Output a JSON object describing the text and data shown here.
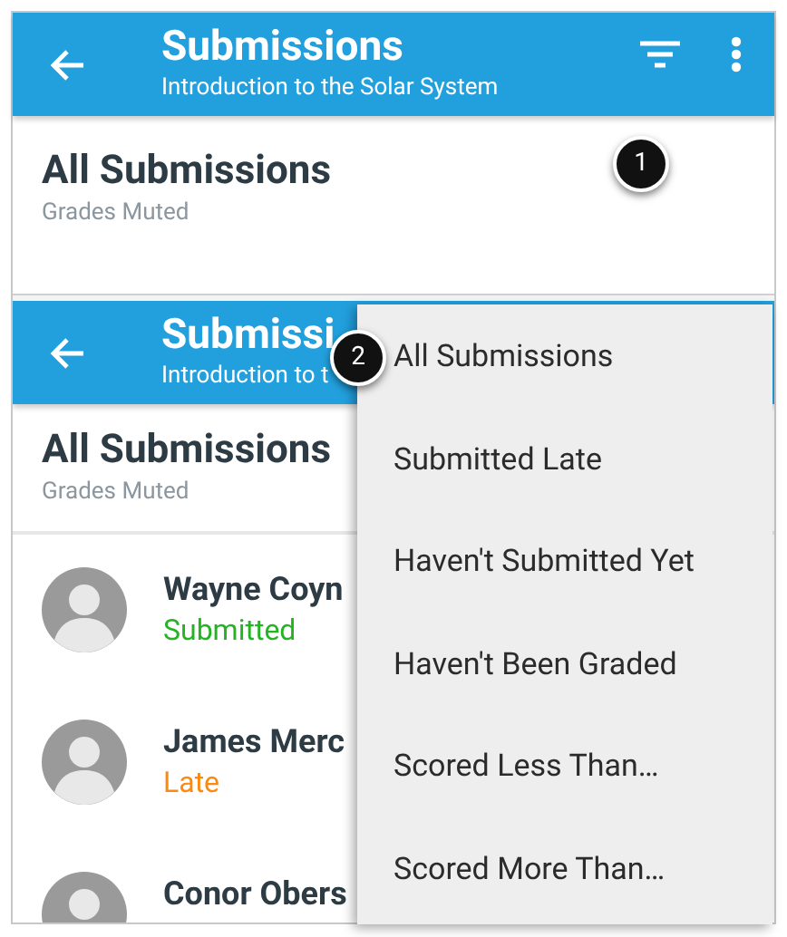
{
  "top_screen": {
    "header": {
      "title": "Submissions",
      "subtitle": "Introduction to the Solar System"
    },
    "list_title": "All Submissions",
    "list_subtitle": "Grades Muted"
  },
  "bottom_screen": {
    "header": {
      "title": "Submissi",
      "subtitle": "Introduction to t"
    },
    "list_title": "All Submissions",
    "list_subtitle": "Grades Muted",
    "students": [
      {
        "name": "Wayne Coyn",
        "status": "Submitted",
        "kind": "submitted"
      },
      {
        "name": "James Merc",
        "status": "Late",
        "kind": "late"
      },
      {
        "name": "Conor Obers",
        "kind": "none"
      }
    ]
  },
  "filter_menu": {
    "items": [
      {
        "label": "All Submissions"
      },
      {
        "label": "Submitted Late"
      },
      {
        "label": "Haven't Submitted Yet"
      },
      {
        "label": "Haven't Been Graded"
      },
      {
        "label": "Scored Less Than…"
      },
      {
        "label": "Scored More Than…"
      }
    ]
  },
  "callouts": [
    "1",
    "2"
  ]
}
